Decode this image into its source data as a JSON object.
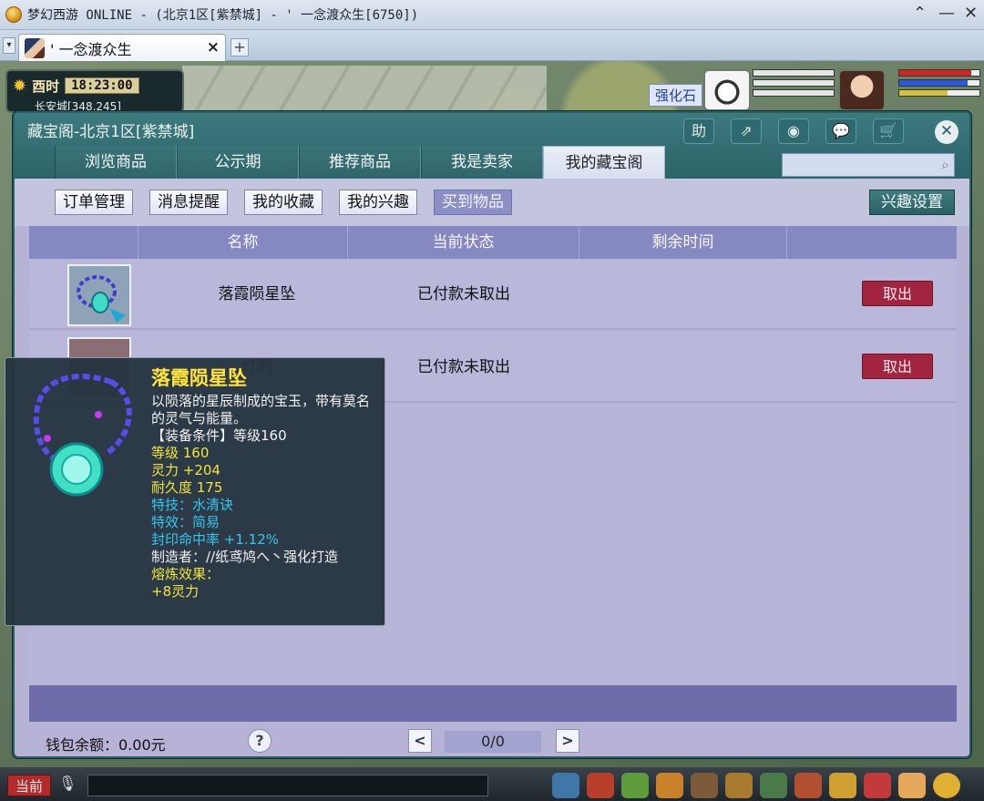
{
  "window": {
    "title": "梦幻西游 ONLINE - (北京1区[紫禁城] - ' 一念渡众生[6750])",
    "tab_label": "' 一念渡众生",
    "tab_close": "×",
    "new_tab": "+"
  },
  "hud": {
    "period": "酉时",
    "clock": "18:23:00",
    "location": "长安城[348,245]",
    "npc_label": "强化石"
  },
  "panel": {
    "title": "藏宝阁-北京1区[紫禁城]",
    "head_icons": [
      "助",
      "⇗",
      "◉",
      "💬",
      "🛒"
    ],
    "close": "✕",
    "main_tabs": [
      {
        "label": "浏览商品",
        "active": false
      },
      {
        "label": "公示期",
        "active": false
      },
      {
        "label": "推荐商品",
        "active": false
      },
      {
        "label": "我是卖家",
        "active": false
      },
      {
        "label": "我的藏宝阁",
        "active": true
      }
    ],
    "search": {
      "placeholder": ""
    },
    "sub_buttons": [
      {
        "label": "订单管理",
        "active": false
      },
      {
        "label": "消息提醒",
        "active": false
      },
      {
        "label": "我的收藏",
        "active": false
      },
      {
        "label": "我的兴趣",
        "active": false
      },
      {
        "label": "买到物品",
        "active": true
      }
    ],
    "interest_setting": "兴趣设置",
    "columns": [
      "",
      "名称",
      "当前状态",
      "剩余时间",
      ""
    ],
    "rows": [
      {
        "name": "落霞陨星坠",
        "status": "已付款未取出",
        "remaining": "",
        "action": "取出"
      },
      {
        "name": "灯豹",
        "status": "已付款未取出",
        "remaining": "",
        "action": "取出"
      }
    ],
    "wallet": "钱包余额：0.00元",
    "help": "?",
    "pager": "0/0",
    "prev": "<",
    "next": ">"
  },
  "tooltip": {
    "name": "落霞陨星坠",
    "desc": "以陨落的星辰制成的宝玉，带有莫名的灵气与能量。",
    "requirement": "【装备条件】等级160",
    "level": "等级 160",
    "spirit": "灵力 +204",
    "durability": "耐久度 175",
    "skill": "特技：水清诀",
    "effect": "特效：简易",
    "seal": "封印命中率 +1.12%",
    "maker": "制造者：//纸鸢鸠へ丶强化打造",
    "refine_label": "熔炼效果：",
    "refine_value": "+8灵力"
  },
  "bottom": {
    "channel": "当前"
  },
  "colors": {
    "panel_header": "#2b6368",
    "panel_body": "#b6b3d6",
    "table_header": "#8588c1",
    "takeout_button": "#a22540",
    "tooltip_name": "#ffe43a",
    "tooltip_yellow": "#f2e63a",
    "tooltip_blue": "#35c7ee"
  }
}
